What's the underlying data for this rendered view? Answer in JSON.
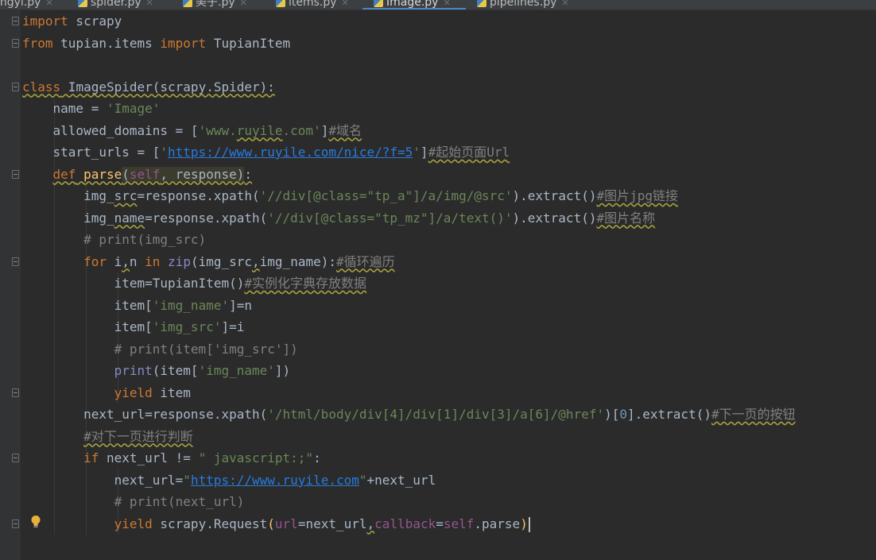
{
  "tabs": [
    {
      "name": "ingyi.py"
    },
    {
      "name": "spider.py"
    },
    {
      "name": "美子.py"
    },
    {
      "name": "items.py"
    },
    {
      "name": "Image.py"
    },
    {
      "name": "pipelines.py"
    }
  ],
  "active_tab": "Image.py",
  "code_lines": [
    "import scrapy",
    "from tupian.items import TupianItem",
    "",
    "class ImageSpider(scrapy.Spider):",
    "    name = 'Image'",
    "    allowed_domains = ['www.ruyile.com']#域名",
    "    start_urls = ['https://www.ruyile.com/nice/?f=5']#起始页面Url",
    "    def parse(self, response):",
    "        img_src=response.xpath('//div[@class=\"tp_a\"]/a/img/@src').extract()#图片jpg链接",
    "        img_name=response.xpath('//div[@class=\"tp_mz\"]/a/text()').extract()#图片名称",
    "        # print(img_src)",
    "        for i,n in zip(img_src,img_name):#循环遍历",
    "            item=TupianItem()#实例化字典存放数据",
    "            item['img_name']=n",
    "            item['img_src']=i",
    "            # print(item['img_src'])",
    "            print(item['img_name'])",
    "            yield item",
    "        next_url=response.xpath('/html/body/div[4]/div[1]/div[3]/a[6]/@href')[0].extract()#下一页的按钮",
    "        #对下一页进行判断",
    "        if next_url != \" javascript:;\":",
    "            next_url=\"https://www.ruyile.com\"+next_url",
    "            # print(next_url)",
    "            yield scrapy.Request(url=next_url,callback=self.parse)"
  ],
  "colors": {
    "background": "#2b2b2b",
    "gutter": "#313335",
    "keyword": "#cc7832",
    "string": "#6a8759",
    "comment": "#808080",
    "function": "#ffc66d",
    "builtin": "#8888c6",
    "self_param": "#94558d",
    "url": "#287bde",
    "number": "#6897bb",
    "text": "#a9b7c6"
  },
  "icons": {
    "tab_icon": "python-file-icon",
    "close": "close-icon",
    "fold": "fold-marker-icon",
    "bulb": "intention-bulb-icon"
  }
}
